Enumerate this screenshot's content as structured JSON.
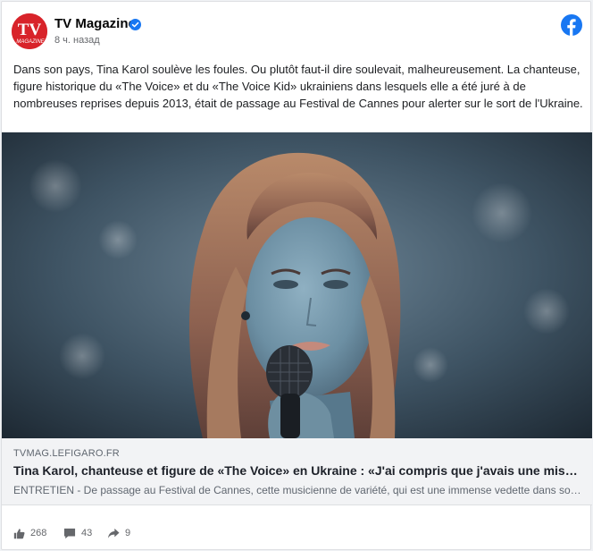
{
  "header": {
    "page_name": "TV Magazine",
    "timestamp": "8 ч. назад",
    "avatar_text": "TV",
    "avatar_subtext": "MAGAZINE"
  },
  "post": {
    "text": "Dans son pays, Tina Karol soulève les foules. Ou plutôt faut-il dire soulevait, malheureusement. La chanteuse, figure historique du «The Voice» et du «The Voice Kid» ukrainiens dans lesquels elle a été juré à de nombreuses reprises depuis 2013, était de passage au Festival de Cannes pour alerter sur le sort de l'Ukraine."
  },
  "link": {
    "domain": "TVMAG.LEFIGARO.FR",
    "title": "Tina Karol, chanteuse et figure de «The Voice» en Ukraine : «J'ai compris que j'avais une mission»",
    "description": "ENTRETIEN - De passage au Festival de Cannes, cette musicienne de variété, qui est une immense vedette dans son pays, raconte son engagement."
  },
  "stats": {
    "likes": "268",
    "comments": "43",
    "shares": "9"
  },
  "colors": {
    "brand_red": "#d8232a",
    "facebook_blue": "#1877f2",
    "verified_blue": "#1877f2"
  },
  "icons": [
    "verified-badge-icon",
    "facebook-logo-icon",
    "like-icon",
    "comment-icon",
    "share-icon"
  ]
}
